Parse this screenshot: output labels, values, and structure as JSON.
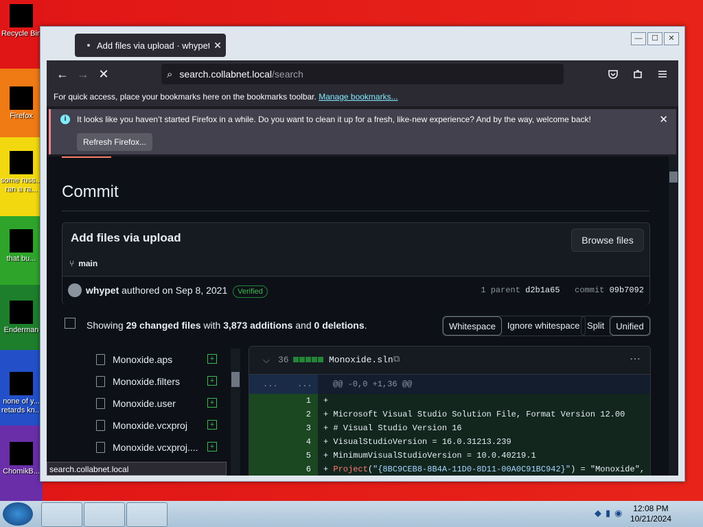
{
  "desktop": {
    "icons": [
      {
        "label": "Recycle Bin"
      },
      {
        "label": "Firefox"
      },
      {
        "label": "some russ... ran a ra..."
      },
      {
        "label": "that bu..."
      },
      {
        "label": "Enderman"
      },
      {
        "label": "none of y... retards kn..."
      },
      {
        "label": "ChomikB..."
      }
    ]
  },
  "window": {
    "tab_title": "Add files via upload · whypet/M",
    "tab_close": "✕",
    "controls": [
      "—",
      "☐",
      "✕"
    ]
  },
  "navbar": {
    "back": "←",
    "forward": "→",
    "stop": "✕",
    "url_host": "search.collabnet.local",
    "url_path": "/search",
    "search_icon": "⌕"
  },
  "bookmarks": {
    "text": "For quick access, place your bookmarks here on the bookmarks toolbar.",
    "link": "Manage bookmarks..."
  },
  "notification": {
    "message": "It looks like you haven’t started Firefox in a while. Do you want to clean it up for a fresh, like-new experience? And by the way, welcome back!",
    "refresh_label": "Refresh Firefox...",
    "close": "✕",
    "info": "i"
  },
  "commit": {
    "heading": "Commit",
    "title": "Add files via upload",
    "browse_label": "Browse files",
    "branch": "main",
    "author": "whypet",
    "authored_on": "authored on Sep 8, 2021",
    "verified": "Verified",
    "parent_label": "1 parent",
    "parent_hash": "d2b1a65",
    "commit_label": "commit",
    "commit_hash": "09b7092"
  },
  "summary": {
    "showing": "Showing",
    "changed_files": "29 changed files",
    "with": "with",
    "additions": "3,873 additions",
    "and": "and",
    "deletions": "0 deletions",
    "period": ".",
    "whitespace": "Whitespace",
    "ignore_whitespace": "Ignore whitespace",
    "split": "Split",
    "unified": "Unified"
  },
  "file_tree": [
    {
      "name": "Monoxide.aps"
    },
    {
      "name": "Monoxide.filters"
    },
    {
      "name": "Monoxide.user"
    },
    {
      "name": "Monoxide.vcxproj"
    },
    {
      "name": "Monoxide.vcxproj...."
    }
  ],
  "diff": {
    "count": "36",
    "filename": "Monoxide.sln",
    "hunk_dots_left": "...",
    "hunk_dots_right": "...",
    "hunk_header": "@@ -0,0 +1,36 @@",
    "lines": [
      {
        "num": "1",
        "text": "+"
      },
      {
        "num": "2",
        "text": "+ Microsoft Visual Studio Solution File, Format Version 12.00"
      },
      {
        "num": "3",
        "text": "+ # Visual Studio Version 16"
      },
      {
        "num": "4",
        "text": "+ VisualStudioVersion = 16.0.31213.239"
      },
      {
        "num": "5",
        "text": "+ MinimumVisualStudioVersion = 10.0.40219.1"
      },
      {
        "num": "6",
        "text_prefix": "+ ",
        "text_kw": "Project",
        "text_mid": "(",
        "text_str": "\"{8BC9CEB8-8B4A-11D0-8D11-00A0C91BC942}\"",
        "text_rest": ") = \"Monoxide\","
      }
    ]
  },
  "status_url": "search.collabnet.local",
  "taskbar": {
    "time": "12:08 PM",
    "date": "10/21/2024"
  }
}
